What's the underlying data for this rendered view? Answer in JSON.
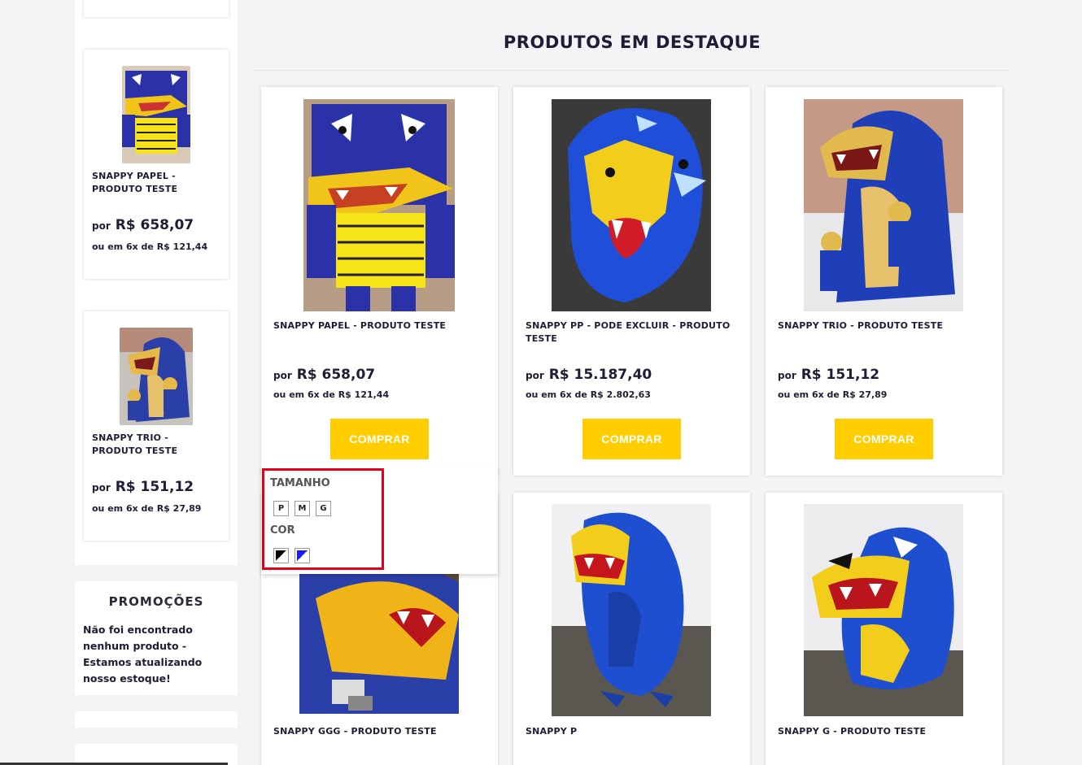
{
  "section": {
    "title": "PRODUTOS EM DESTAQUE"
  },
  "sidebar": {
    "products": [
      {
        "name": "SNAPPY PAPEL - PRODUTO TESTE",
        "price_prefix": "por",
        "price": "R$ 658,07",
        "installments": "ou em 6x de R$ 121,44"
      },
      {
        "name": "SNAPPY TRIO - PRODUTO TESTE",
        "price_prefix": "por",
        "price": "R$ 151,12",
        "installments": "ou em 6x de R$ 27,89"
      }
    ],
    "promo": {
      "title": "PROMOÇÕES",
      "text": "Não foi encontrado nenhum produto - Estamos atualizando nosso estoque!"
    }
  },
  "products": [
    {
      "name": "SNAPPY PAPEL - PRODUTO TESTE",
      "price_prefix": "por",
      "price": "R$ 658,07",
      "installments": "ou em 6x de R$ 121,44",
      "buy_label": "COMPRAR"
    },
    {
      "name": "SNAPPY PP - PODE EXCLUIR - PRODUTO TESTE",
      "price_prefix": "por",
      "price": "R$ 15.187,40",
      "installments": "ou em 6x de R$ 2.802,63",
      "buy_label": "COMPRAR"
    },
    {
      "name": "SNAPPY TRIO - PRODUTO TESTE",
      "price_prefix": "por",
      "price": "R$ 151,12",
      "installments": "ou em 6x de R$ 27,89",
      "buy_label": "COMPRAR"
    },
    {
      "name": "SNAPPY GGG - PRODUTO TESTE"
    },
    {
      "name": "SNAPPY P"
    },
    {
      "name": "SNAPPY G - PRODUTO TESTE"
    }
  ],
  "variants": {
    "size_label": "TAMANHO",
    "sizes": [
      "P",
      "M",
      "G"
    ],
    "color_label": "COR",
    "colors": [
      "#000000",
      "#1a1aff"
    ]
  },
  "colors": {
    "accent": "#ffcd00",
    "highlight": "#e3001b",
    "text": "#1d1d35"
  }
}
